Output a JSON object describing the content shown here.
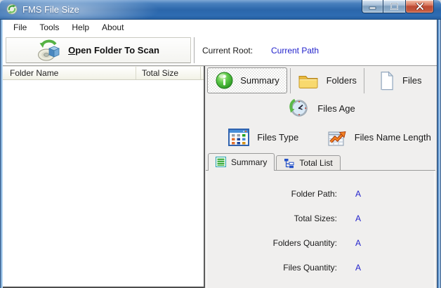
{
  "titlebar": {
    "title": "FMS File Size",
    "app_icon": "gear-recycle-icon",
    "controls": [
      "minimize",
      "maximize",
      "close"
    ]
  },
  "menu": {
    "items": [
      {
        "label": "File"
      },
      {
        "label": "Tools"
      },
      {
        "label": "Help"
      },
      {
        "label": "About"
      }
    ]
  },
  "toolbar": {
    "open_button": {
      "label_accel": "O",
      "label_rest": "pen Folder To Scan",
      "icon": "scan-disc-cube-icon"
    },
    "current_root_label": "Current Root:",
    "current_root_value": "Current Path"
  },
  "folder_list": {
    "columns": [
      {
        "label": "Folder Name"
      },
      {
        "label": "Total Size"
      }
    ],
    "rows": []
  },
  "nav": {
    "buttons": [
      {
        "label": "Summary",
        "icon": "summary-info-sphere-icon",
        "active": true
      },
      {
        "label": "Folders",
        "icon": "folders-icon",
        "active": false
      },
      {
        "label": "Files",
        "icon": "files-page-icon",
        "active": false
      },
      {
        "label": "Files Age",
        "icon": "files-age-clock-icon",
        "active": false
      },
      {
        "label": "Files Type",
        "icon": "files-type-grid-icon",
        "active": false
      },
      {
        "label": "Files Name Length",
        "icon": "files-name-length-chart-icon",
        "active": false
      }
    ]
  },
  "tabs": {
    "items": [
      {
        "label": "Summary",
        "icon": "summary-list-icon",
        "active": true
      },
      {
        "label": "Total List",
        "icon": "total-list-tree-icon",
        "active": false
      }
    ]
  },
  "summary_panel": {
    "fields": [
      {
        "label": "Folder Path:",
        "value": "A"
      },
      {
        "label": "Total Sizes:",
        "value": "A"
      },
      {
        "label": "Folders Quantity:",
        "value": "A"
      },
      {
        "label": "Files Quantity:",
        "value": "A"
      }
    ]
  },
  "colors": {
    "titlebar_blue": "#2e6cb2",
    "close_button_red": "#bc4a33",
    "value_link_blue": "#2323cc",
    "panel_gray": "#f0efee",
    "folder_yellow": "#f6d066",
    "summary_green": "#45b535"
  }
}
